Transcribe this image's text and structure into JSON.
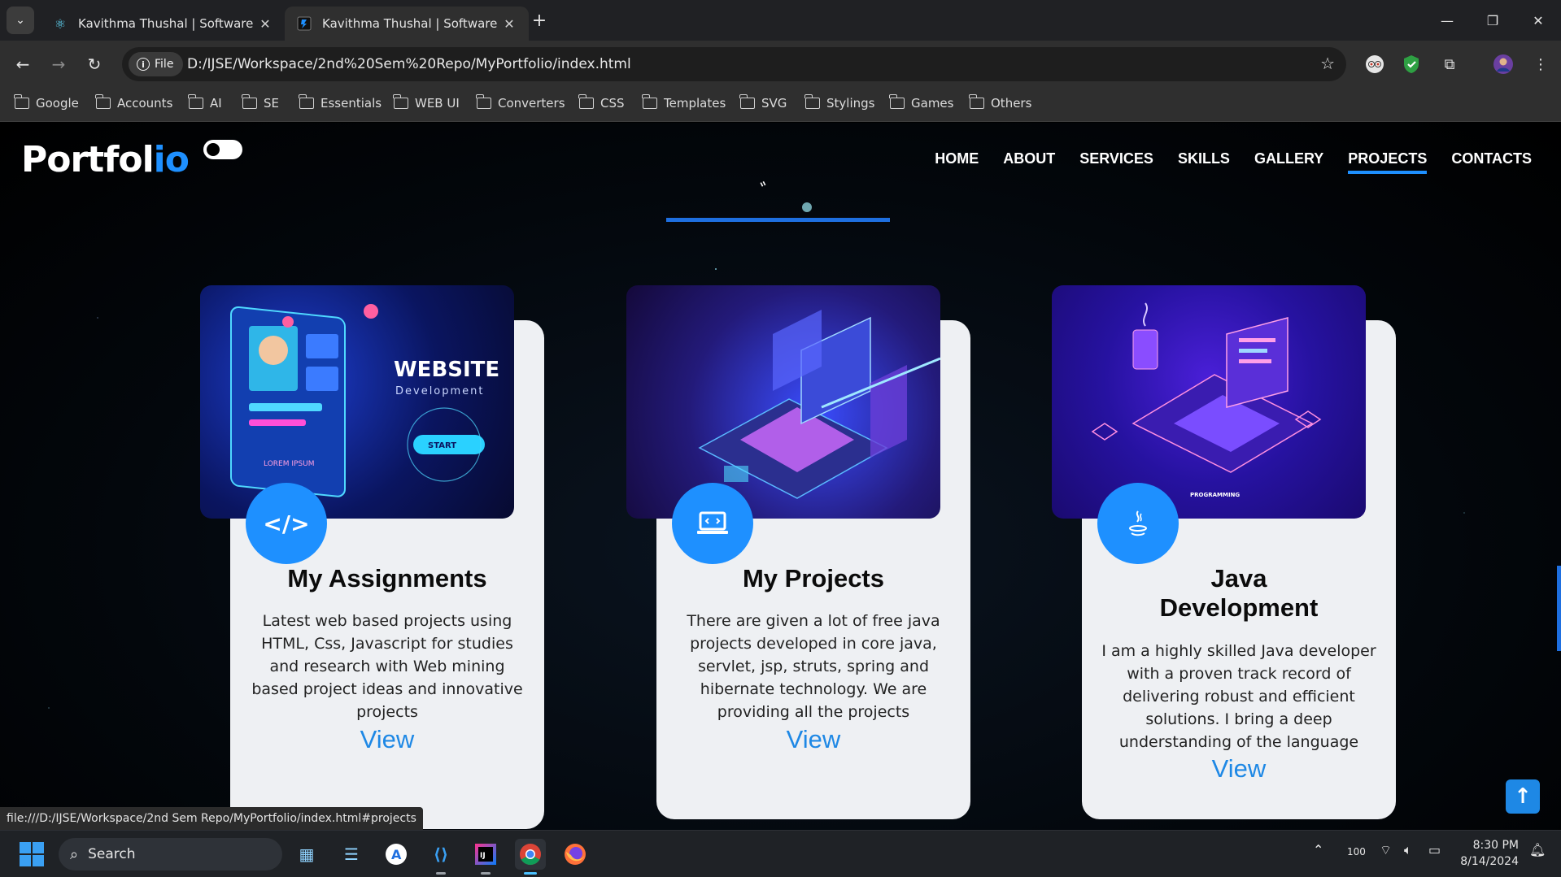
{
  "browser": {
    "tabs": [
      {
        "title": "Kavithma Thushal | Software En",
        "active": false
      },
      {
        "title": "Kavithma Thushal | Software En",
        "active": true
      }
    ],
    "file_chip": "File",
    "url": "D:/IJSE/Workspace/2nd%20Sem%20Repo/MyPortfolio/index.html",
    "bookmarks": [
      "Google",
      "Accounts",
      "AI",
      "SE",
      "Essentials",
      "WEB UI",
      "Converters",
      "CSS",
      "Templates",
      "SVG",
      "Stylings",
      "Games",
      "Others"
    ],
    "status_url": "file:///D:/IJSE/Workspace/2nd Sem Repo/MyPortfolio/index.html#projects"
  },
  "site": {
    "logo_main": "Portfol",
    "logo_accent": "io",
    "nav": [
      "HOME",
      "ABOUT",
      "SERVICES",
      "SKILLS",
      "GALLERY",
      "PROJECTS",
      "CONTACTS"
    ],
    "active_nav": "PROJECTS",
    "cards": [
      {
        "title": "My Assignments",
        "description": "Latest web based projects using HTML, Css, Javascript for studies and research with Web mining based project ideas and innovative projects",
        "link": "View",
        "image_text_1": "WEBSITE",
        "image_text_2": "Development",
        "image_text_3": "START",
        "image_text_4": "LOREM IPSUM",
        "badge_icon": "code-icon"
      },
      {
        "title": "My Projects",
        "description": "There are given a lot of free java projects developed in core java, servlet, jsp, struts, spring and hibernate technology. We are providing all the projects",
        "link": "View",
        "badge_icon": "laptop-code-icon"
      },
      {
        "title": "Java Development",
        "description": "I am a highly skilled Java developer with a proven track record of delivering robust and efficient solutions. I bring a deep understanding of the language",
        "link": "View",
        "image_text_1": "PROGRAMMING",
        "badge_icon": "java-icon"
      }
    ]
  },
  "taskbar": {
    "search_label": "Search",
    "battery": "100",
    "time": "8:30 PM",
    "date": "8/14/2024"
  },
  "colors": {
    "accent": "#1e90ff",
    "card_bg": "#eef0f3",
    "link": "#1e88e5"
  }
}
